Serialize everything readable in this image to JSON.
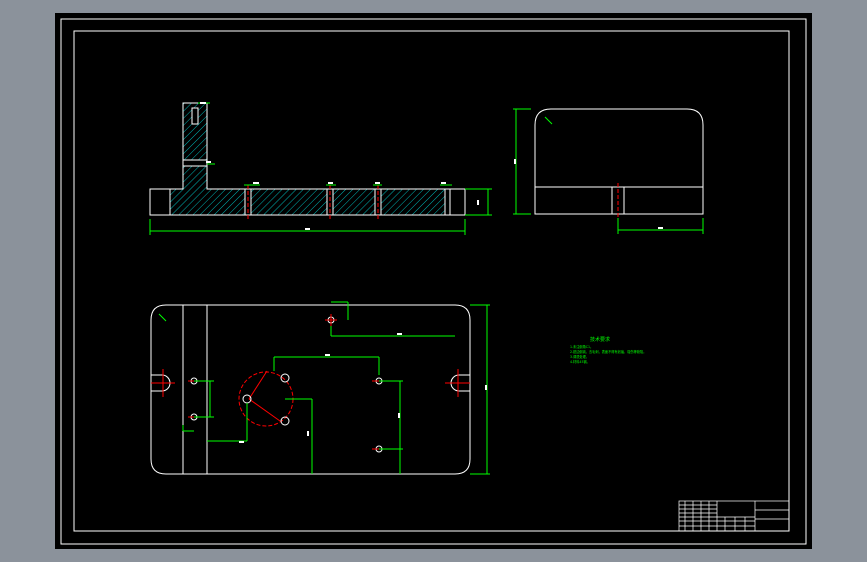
{
  "drawing": {
    "notes_title": "技术要求",
    "notes_lines": [
      "1.未注倒角C1。",
      "2.锐边倒钝，去毛刺，表面不得有划痕、碰伤等缺陷。",
      "3.调质处理。",
      "4.材料45钢。"
    ],
    "colors": {
      "background": "#000000",
      "outline": "#ffffff",
      "dimension": "#00ff00",
      "centerline": "#ff0000",
      "hatch": "#00c8c8",
      "window_frame": "#8b929b"
    }
  }
}
